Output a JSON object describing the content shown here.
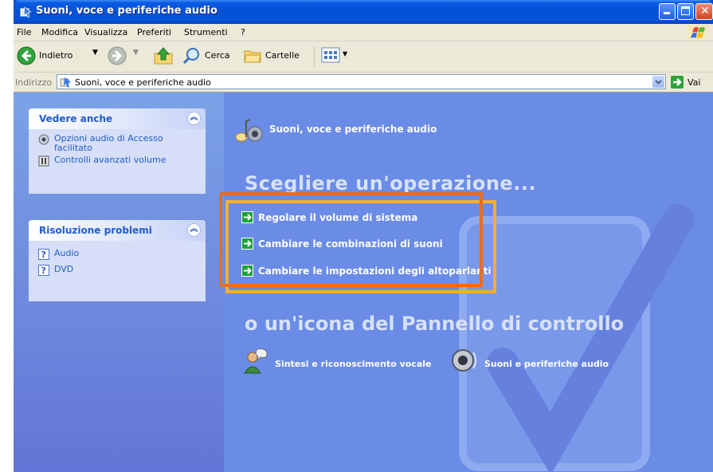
{
  "window": {
    "title": "Suoni, voce e periferiche audio"
  },
  "menu": [
    "File",
    "Modifica",
    "Visualizza",
    "Preferiti",
    "Strumenti",
    "?"
  ],
  "toolbar": {
    "back_label": "Indietro",
    "search_label": "Cerca",
    "folders_label": "Cartelle"
  },
  "address": {
    "label": "Indirizzo",
    "value": "Suoni, voce e periferiche audio",
    "go_label": "Vai"
  },
  "left_panels": {
    "see_also": {
      "title": "Vedere anche",
      "links": [
        "Opzioni audio di Accesso facilitato",
        "Controlli avanzati volume"
      ]
    },
    "troubleshoot": {
      "title": "Risoluzione problemi",
      "links": [
        "Audio",
        "DVD"
      ]
    }
  },
  "main": {
    "header_title": "Suoni, voce e periferiche audio",
    "choose_task": "Scegliere un'operazione...",
    "tasks": [
      "Regolare il volume di sistema",
      "Cambiare le combinazioni di suoni",
      "Cambiare le impostazioni degli altoparlanti"
    ],
    "or_icon": "o un'icona del Pannello di controllo",
    "icons": [
      "Sintesi e riconoscimento vocale",
      "Suoni e periferiche audio"
    ]
  },
  "colors": {
    "titlebar": "#0552d6",
    "content_bg": "#6a8be6",
    "highlight_orange": "#f06b17",
    "highlight_yellow": "#f7b02a"
  }
}
